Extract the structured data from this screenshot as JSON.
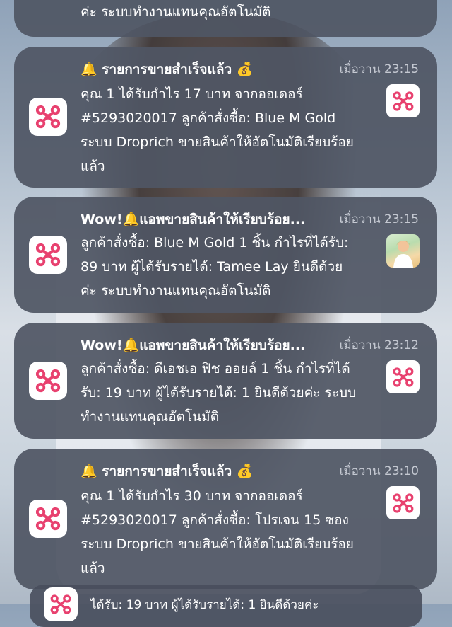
{
  "accent_color": "#e8416f",
  "notifications": [
    {
      "app_icon": "drone-icon",
      "title": "",
      "time": "",
      "body_lines": [
        "ค่ะ ระบบทำงานแทนคุณอัตโนมัติ"
      ]
    },
    {
      "app_icon": "drone-icon",
      "title_prefix_icon": "bell-icon",
      "title": "รายการขายสำเร็จแล้ว",
      "title_suffix_icon": "money-bag-icon",
      "time": "เมื่อวาน 23:15",
      "thumb": "drone-icon",
      "body_lines": [
        "คุณ 1 ได้รับกำไร 17 บาท จากออเดอร์",
        "#5293020017 ลูกค้าสั่งซื้อ: Blue M Gold",
        "ระบบ Droprich ขายสินค้าให้อัตโนมัติเรียบร้อย",
        "แล้ว"
      ]
    },
    {
      "app_icon": "drone-icon",
      "title_start": "Wow!",
      "title_icon": "bell-icon",
      "title_end": "แอพขายสินค้าให้เรียบร้อย...",
      "time": "เมื่อวาน 23:15",
      "thumb": "photo-thumbnail",
      "body_lines": [
        "ลูกค้าสั่งซื้อ: Blue M Gold 1 ชิ้น กำไรที่ได้รับ:",
        "89 บาท ผู้ได้รับรายได้: Tamee Lay ยินดีด้วย",
        "ค่ะ ระบบทำงานแทนคุณอัตโนมัติ"
      ]
    },
    {
      "app_icon": "drone-icon",
      "title_start": "Wow!",
      "title_icon": "bell-icon",
      "title_end": "แอพขายสินค้าให้เรียบร้อย...",
      "time": "เมื่อวาน 23:12",
      "thumb": "drone-icon",
      "body_lines": [
        "ลูกค้าสั่งซื้อ: ดีเอชเอ ฟิช ออยล์ 1 ชิ้น กำไรที่ได้",
        "รับ: 19 บาท ผู้ได้รับรายได้: 1 ยินดีด้วยค่ะ ระบบ",
        "ทำงานแทนคุณอัตโนมัติ"
      ]
    },
    {
      "app_icon": "drone-icon",
      "title_prefix_icon": "bell-icon",
      "title": "รายการขายสำเร็จแล้ว",
      "title_suffix_icon": "money-bag-icon",
      "time": "เมื่อวาน 23:10",
      "thumb": "drone-icon",
      "body_lines": [
        "คุณ 1 ได้รับกำไร 30 บาท จากออเดอร์",
        "#5293020017 ลูกค้าสั่งซื้อ: โปรเจน 15 ซอง",
        "ระบบ Droprich ขายสินค้าให้อัตโนมัติเรียบร้อย",
        "แล้ว"
      ]
    },
    {
      "app_icon": "drone-icon",
      "body_lines": [
        "ได้รับ: 19 บาท ผู้ได้รับรายได้: 1 ยินดีด้วยค่ะ"
      ]
    }
  ]
}
